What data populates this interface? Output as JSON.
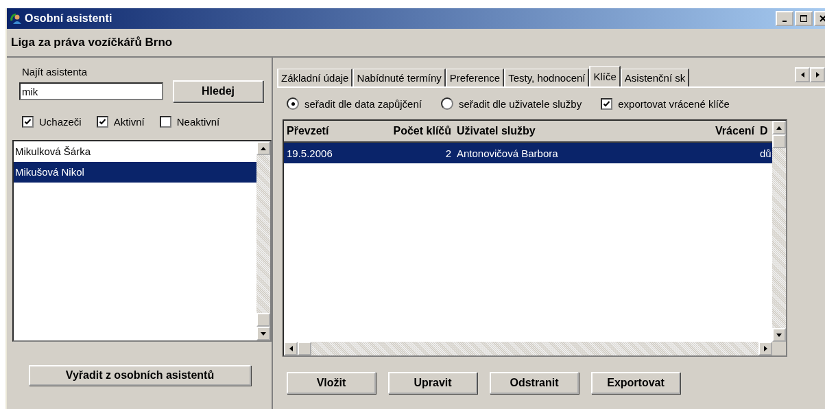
{
  "window": {
    "title": "Osobní asistenti"
  },
  "header": "Liga za práva vozíčkářů Brno",
  "search": {
    "label": "Najít asistenta",
    "value": "mik",
    "button": "Hledej"
  },
  "filters": [
    {
      "label": "Uchazeči",
      "checked": true
    },
    {
      "label": "Aktivní",
      "checked": true
    },
    {
      "label": "Neaktivní",
      "checked": false
    }
  ],
  "assistants": [
    {
      "name": "Mikulková Šárka",
      "selected": false
    },
    {
      "name": "Mikušová Nikol",
      "selected": true
    }
  ],
  "remove_button": "Vyřadit z osobních asistentů",
  "tabs": [
    {
      "label": "Základní údaje",
      "selected": false
    },
    {
      "label": "Nabídnuté termíny",
      "selected": false
    },
    {
      "label": "Preference",
      "selected": false
    },
    {
      "label": "Testy, hodnocení",
      "selected": false
    },
    {
      "label": "Klíče",
      "selected": true
    },
    {
      "label": "Asistenční sk",
      "selected": false
    }
  ],
  "sort_options": [
    {
      "label": "seřadit dle data zapůjčení",
      "selected": true
    },
    {
      "label": "seřadit dle uživatele služby",
      "selected": false
    }
  ],
  "export_option": {
    "label": "exportovat vrácené klíče",
    "checked": true
  },
  "table": {
    "columns": [
      "Převzetí",
      "Počet klíčů",
      "Uživatel služby",
      "Vrácení",
      "D"
    ],
    "rows": [
      {
        "cells": [
          "19.5.2006",
          "2",
          "Antonovičová Barbora",
          "",
          "dů"
        ],
        "selected": true
      }
    ]
  },
  "buttons": [
    "Vložit",
    "Upravit",
    "Odstranit",
    "Exportovat"
  ]
}
